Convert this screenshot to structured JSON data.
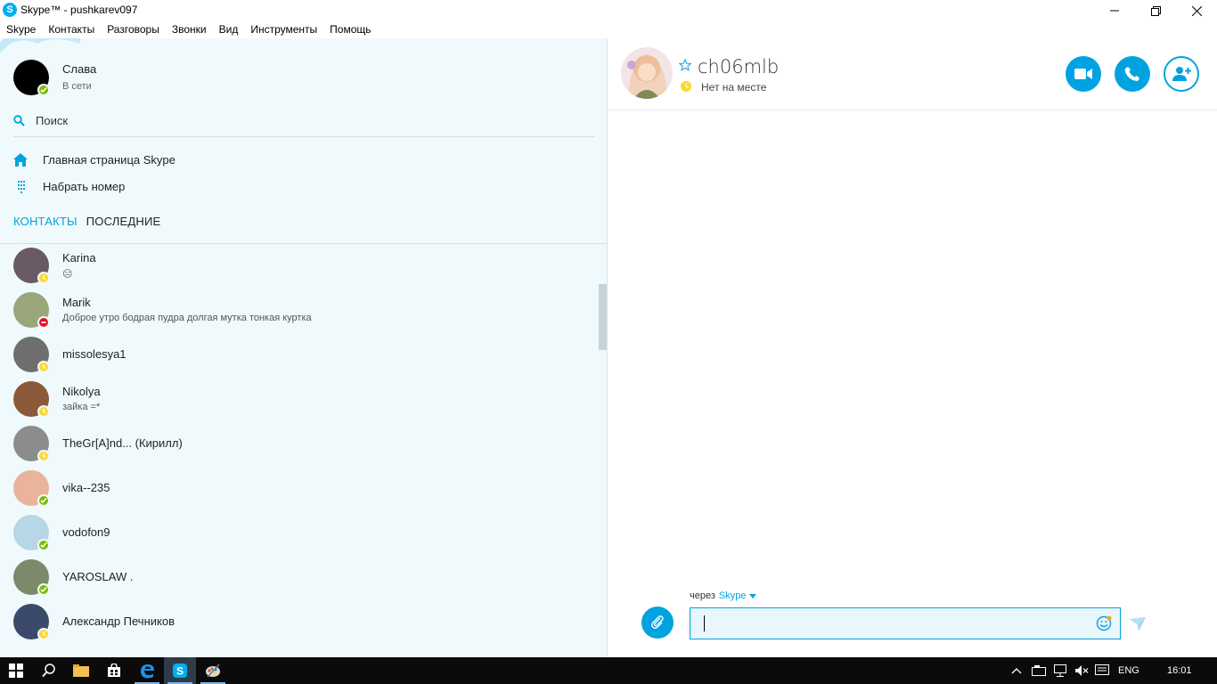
{
  "window": {
    "title": "Skype™ - pushkarev097",
    "app_icon_letter": "S"
  },
  "menu": [
    "Skype",
    "Контакты",
    "Разговоры",
    "Звонки",
    "Вид",
    "Инструменты",
    "Помощь"
  ],
  "profile": {
    "name": "Слава",
    "status": "В сети"
  },
  "search": {
    "label": "Поиск"
  },
  "nav": {
    "home": "Главная страница Skype",
    "dial": "Набрать номер"
  },
  "tabs": {
    "contacts": "КОНТАКТЫ",
    "recent": "ПОСЛЕДНИЕ"
  },
  "contacts": [
    {
      "name": "Karina",
      "mood": "😑",
      "presence": "away",
      "avatar_color": "#6a5a66"
    },
    {
      "name": "Marik",
      "mood": "Доброе утро бодрая пудра долгая мутка тонкая куртка",
      "presence": "dnd",
      "avatar_color": "#9aa57a"
    },
    {
      "name": "missolesya1",
      "mood": "",
      "presence": "away",
      "avatar_color": "#6e6e6e"
    },
    {
      "name": "Nikolya",
      "mood": "зайка =*",
      "presence": "away",
      "avatar_color": "#8a5a3a"
    },
    {
      "name": "TheGr[A]nd... (Кирилл)",
      "mood": "",
      "presence": "away",
      "avatar_color": "#8c8c8c"
    },
    {
      "name": "vika--235",
      "mood": "",
      "presence": "online",
      "avatar_color": "#e9b39c"
    },
    {
      "name": "vodofon9",
      "mood": "",
      "presence": "online",
      "avatar_color": "#b7d6e6"
    },
    {
      "name": "YAROSLAW .",
      "mood": "",
      "presence": "online",
      "avatar_color": "#7c8a6a"
    },
    {
      "name": "Александр Печников",
      "mood": "",
      "presence": "away",
      "avatar_color": "#3b4a6b"
    }
  ],
  "chat": {
    "name": "ch06mlb",
    "status": "Нет на месте",
    "via_label": "через",
    "via_service": "Skype",
    "input_value": "",
    "input_placeholder": ""
  },
  "taskbar": {
    "language": "ENG",
    "time": "16:01"
  },
  "colors": {
    "accent": "#00a3e0",
    "online": "#7fba00",
    "away": "#fdd835",
    "dnd": "#e81123",
    "left_bg": "#f0fafd"
  }
}
